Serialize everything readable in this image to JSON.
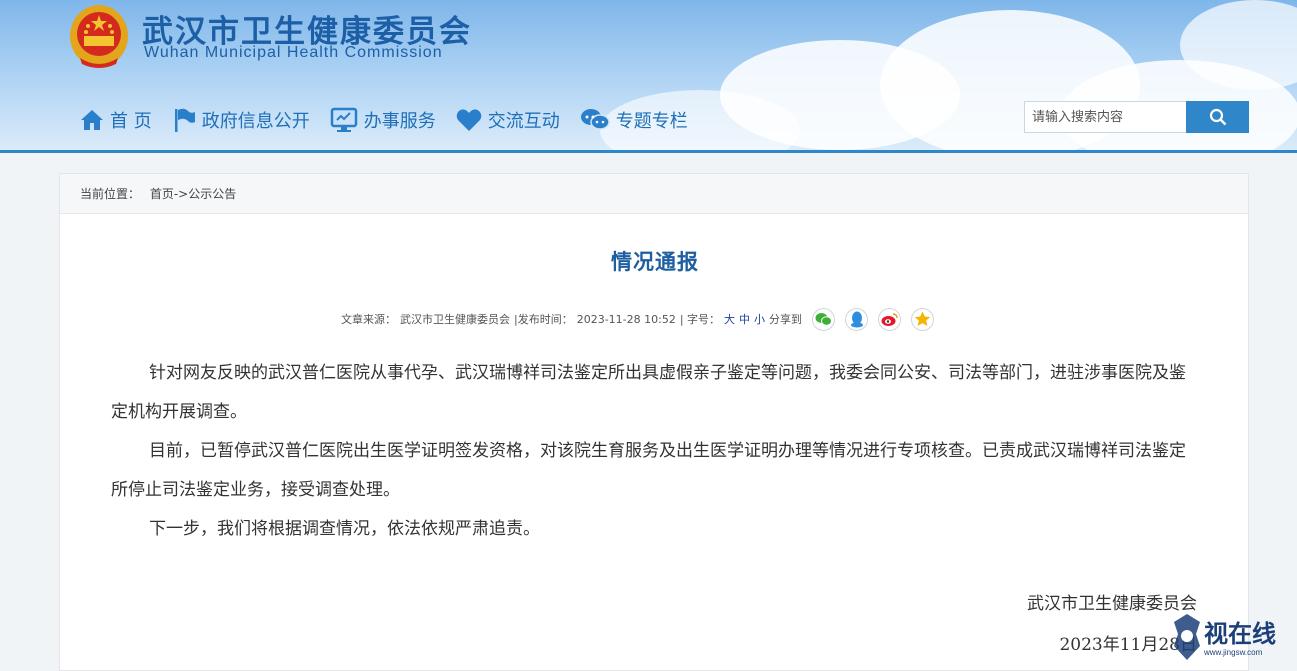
{
  "site": {
    "title_cn": "武汉市卫生健康委员会",
    "title_en": "Wuhan Municipal Health Commission"
  },
  "nav": [
    {
      "label": "首 页",
      "icon": "home-icon"
    },
    {
      "label": "政府信息公开",
      "icon": "flag-icon"
    },
    {
      "label": "办事服务",
      "icon": "monitor-icon"
    },
    {
      "label": "交流互动",
      "icon": "heart-icon"
    },
    {
      "label": "专题专栏",
      "icon": "chat-bubbles-icon"
    }
  ],
  "search": {
    "placeholder": "请输入搜索内容",
    "button_icon": "search-icon"
  },
  "breadcrumb": {
    "label": "当前位置：",
    "path": "首页->公示公告"
  },
  "article": {
    "title": "情况通报",
    "meta": {
      "source_label": "文章来源：",
      "source": "武汉市卫生健康委员会",
      "time_label": "|发布时间：",
      "time": "2023-11-28 10:52",
      "font_label": "| 字号：",
      "font_sizes": [
        "大",
        "中",
        "小"
      ],
      "share_label": "分享到"
    },
    "share_icons": [
      "wechat-icon",
      "qq-icon",
      "weibo-icon",
      "qzone-icon"
    ],
    "paragraphs": [
      "针对网友反映的武汉普仁医院从事代孕、武汉瑞博祥司法鉴定所出具虚假亲子鉴定等问题，我委会同公安、司法等部门，进驻涉事医院及鉴定机构开展调查。",
      "目前，已暂停武汉普仁医院出生医学证明签发资格，对该院生育服务及出生医学证明办理等情况进行专项核查。已责成武汉瑞博祥司法鉴定所停止司法鉴定业务，接受调查处理。",
      "下一步，我们将根据调查情况，依法依规严肃追责。"
    ],
    "signature": "武汉市卫生健康委员会",
    "date": "2023年11月28日"
  },
  "watermark": {
    "text": "视在线",
    "url": "www.jingsw.com"
  },
  "colors": {
    "brand_blue": "#1d5fa6",
    "nav_blue": "#1f6fb8",
    "search_button": "#2f87c9"
  }
}
